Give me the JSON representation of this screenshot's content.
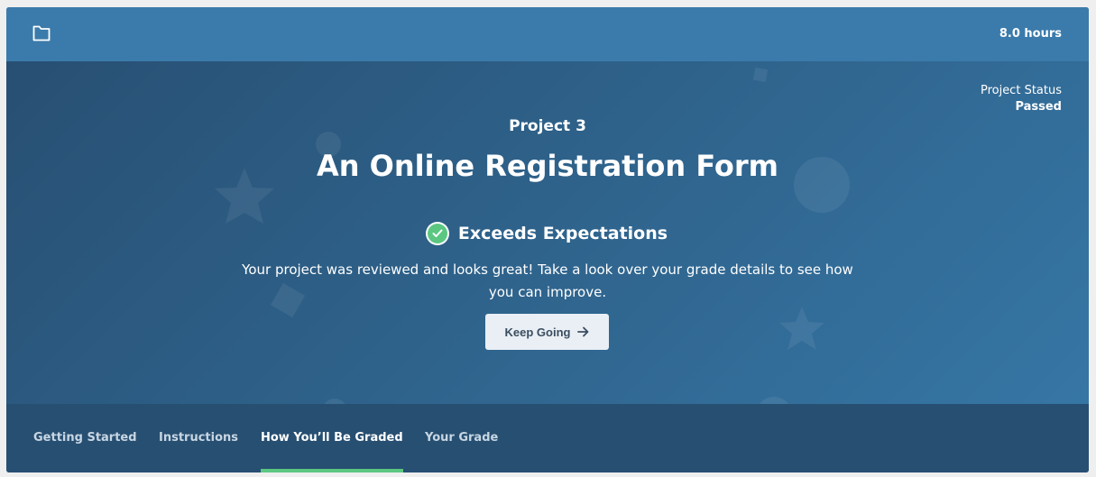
{
  "header": {
    "hours": "8.0 hours",
    "icon": "folder-icon"
  },
  "status": {
    "label": "Project Status",
    "value": "Passed"
  },
  "project": {
    "number": "Project 3",
    "title": "An Online Registration Form"
  },
  "result": {
    "text": "Exceeds Expectations",
    "icon": "check-circle-icon",
    "message": "Your project was reviewed and looks great! Take a look over your grade details to see how you can improve."
  },
  "cta": {
    "label": "Keep Going",
    "icon": "arrow-right-icon"
  },
  "tabs": [
    {
      "label": "Getting Started",
      "active": false
    },
    {
      "label": "Instructions",
      "active": false
    },
    {
      "label": "How You’ll Be Graded",
      "active": true
    },
    {
      "label": "Your Grade",
      "active": false
    }
  ],
  "colors": {
    "topbar": "#3b7bab",
    "hero_dark": "#284f73",
    "hero_light": "#3676a5",
    "tabs_bg": "#274f72",
    "accent_green": "#5bc781",
    "button_bg": "#e9eff5"
  }
}
